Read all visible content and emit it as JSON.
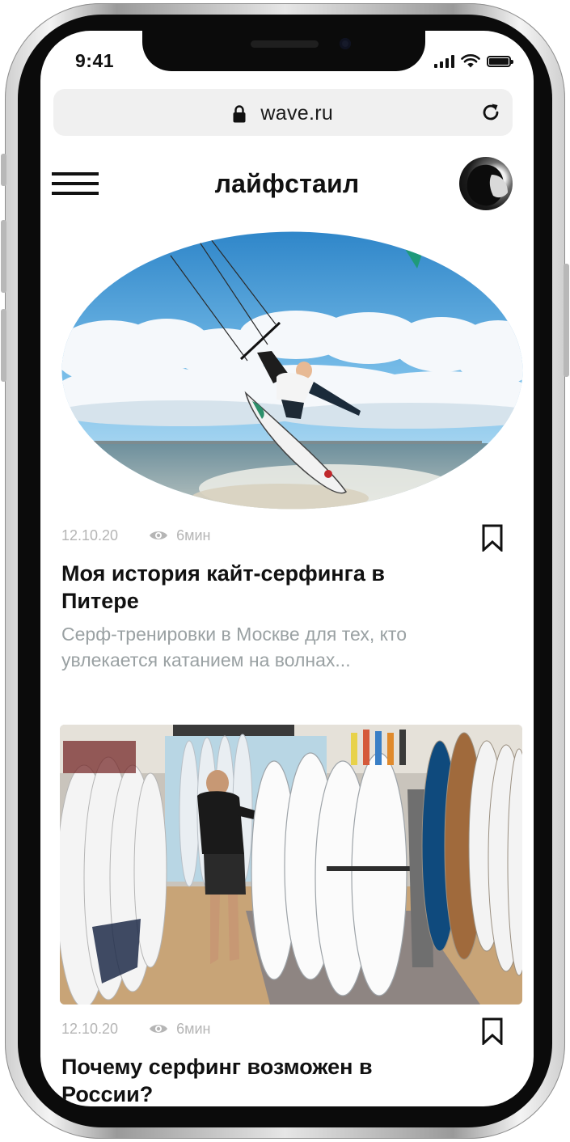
{
  "status_bar": {
    "time": "9:41"
  },
  "browser": {
    "url": "wave.ru"
  },
  "header": {
    "title": "лайфстаил"
  },
  "articles": [
    {
      "date": "12.10.20",
      "read_time": "6мин",
      "title": "Моя история кайт-серфинга в Питере",
      "excerpt": "Серф-тренировки в Москве для тех, кто увлекается катанием на волнах..."
    },
    {
      "date": "12.10.20",
      "read_time": "6мин",
      "title": "Почему серфинг возможен в России?"
    }
  ],
  "colors": {
    "text": "#111111",
    "meta": "#b5b5b5",
    "excerpt": "#9aa1a3",
    "address_bar_bg": "#f0f0f0",
    "sky": "#4a9fd6"
  }
}
